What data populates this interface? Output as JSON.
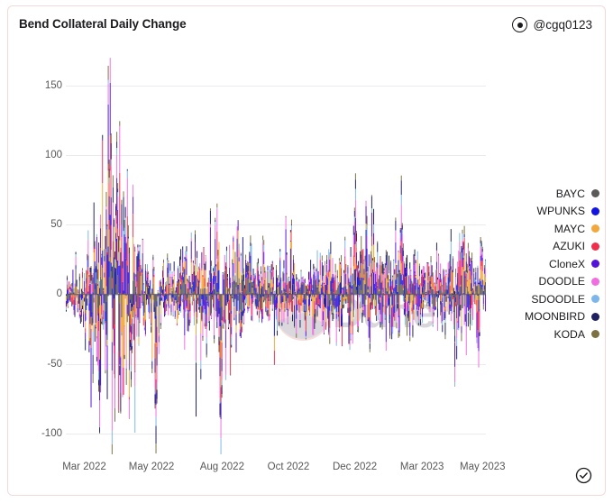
{
  "header": {
    "title": "Bend Collateral Daily Change",
    "author_handle": "@cgq0123",
    "author_icon": "dot-circle-icon"
  },
  "footer": {
    "verified_icon": "check-circle-icon"
  },
  "watermark": {
    "text": "Dune",
    "logo_icon": "dune-logo-icon",
    "logo_color": "#f7dede",
    "text_color": "#d8d6da"
  },
  "chart_data": {
    "type": "bar",
    "title": "Bend Collateral Daily Change",
    "xlabel": "",
    "ylabel": "",
    "ylim": [
      -115,
      170
    ],
    "yticks": [
      150,
      100,
      50,
      0,
      -50,
      -100
    ],
    "ytick_labels": [
      "150",
      "100",
      "50",
      "0",
      "-50",
      "-100"
    ],
    "xticks": [
      "Mar 2022",
      "May 2022",
      "Aug 2022",
      "Oct 2022",
      "Dec 2022",
      "Mar 2023",
      "May 2023"
    ],
    "xtick_positions": [
      0.044,
      0.204,
      0.372,
      0.53,
      0.688,
      0.848,
      0.992
    ],
    "grid": true,
    "legend_position": "right",
    "stacked": true,
    "bar_count": 440,
    "series": [
      {
        "name": "BAYC",
        "color": "#5a5a5a",
        "amplitude_up": 22,
        "amplitude_down": 20,
        "seed": 11
      },
      {
        "name": "WPUNKS",
        "color": "#1414e0",
        "amplitude_up": 20,
        "amplitude_down": 18,
        "seed": 23
      },
      {
        "name": "MAYC",
        "color": "#f2a83c",
        "amplitude_up": 28,
        "amplitude_down": 30,
        "seed": 37
      },
      {
        "name": "AZUKI",
        "color": "#ef2e4e",
        "amplitude_up": 24,
        "amplitude_down": 22,
        "seed": 53
      },
      {
        "name": "CloneX",
        "color": "#5412d9",
        "amplitude_up": 22,
        "amplitude_down": 24,
        "seed": 71
      },
      {
        "name": "DOODLE",
        "color": "#f06fe0",
        "amplitude_up": 20,
        "amplitude_down": 26,
        "seed": 89
      },
      {
        "name": "SDOODLE",
        "color": "#7db6ea",
        "amplitude_up": 10,
        "amplitude_down": 9,
        "seed": 101
      },
      {
        "name": "MOONBIRD",
        "color": "#1e2060",
        "amplitude_up": 14,
        "amplitude_down": 13,
        "seed": 113
      },
      {
        "name": "KODA",
        "color": "#7d7043",
        "amplitude_up": 8,
        "amplitude_down": 7,
        "seed": 131
      }
    ],
    "peak_annotations": [
      {
        "x_fraction": 0.105,
        "value": 160,
        "note": "largest positive spike near Apr 2022"
      },
      {
        "x_fraction": 0.12,
        "value": 101,
        "note": "secondary positive spike"
      },
      {
        "x_fraction": 0.37,
        "value": -107,
        "note": "largest negative spike near Aug 2022"
      },
      {
        "x_fraction": 0.215,
        "value": -99,
        "note": "negative spike near May 2022"
      },
      {
        "x_fraction": 0.155,
        "value": -63,
        "note": "negative spike"
      },
      {
        "x_fraction": 0.69,
        "value": 70,
        "note": "positive spike near Jan 2023"
      },
      {
        "x_fraction": 0.8,
        "value": 68,
        "note": "positive spike near Mar 2023"
      },
      {
        "x_fraction": 0.99,
        "value": 50,
        "note": "positive spike near May 2023"
      }
    ]
  },
  "legend": {
    "items": [
      {
        "label": "BAYC",
        "color": "#5a5a5a"
      },
      {
        "label": "WPUNKS",
        "color": "#1414e0"
      },
      {
        "label": "MAYC",
        "color": "#f2a83c"
      },
      {
        "label": "AZUKI",
        "color": "#ef2e4e"
      },
      {
        "label": "CloneX",
        "color": "#5412d9"
      },
      {
        "label": "DOODLE",
        "color": "#f06fe0"
      },
      {
        "label": "SDOODLE",
        "color": "#7db6ea"
      },
      {
        "label": "MOONBIRD",
        "color": "#1e2060"
      },
      {
        "label": "KODA",
        "color": "#7d7043"
      }
    ]
  }
}
